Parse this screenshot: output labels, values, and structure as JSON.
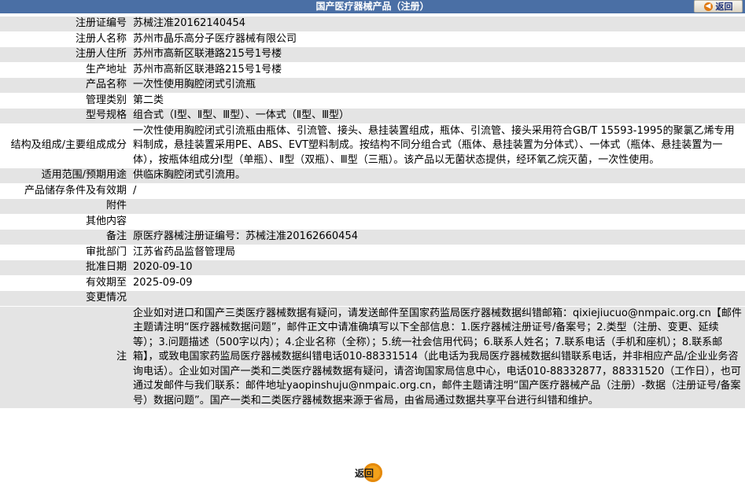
{
  "header": {
    "title": "国产医疗器械产品（注册）",
    "back_label": "返回"
  },
  "rows": [
    {
      "label": "注册证编号",
      "value": "苏械注准20162140454"
    },
    {
      "label": "注册人名称",
      "value": "苏州市晶乐高分子医疗器械有限公司"
    },
    {
      "label": "注册人住所",
      "value": "苏州市高新区联港路215号1号楼"
    },
    {
      "label": "生产地址",
      "value": "苏州市高新区联港路215号1号楼"
    },
    {
      "label": "产品名称",
      "value": "一次性使用胸腔闭式引流瓶"
    },
    {
      "label": "管理类别",
      "value": "第二类"
    },
    {
      "label": "型号规格",
      "value": "组合式（Ⅰ型、Ⅱ型、Ⅲ型）、一体式（Ⅱ型、Ⅲ型）"
    },
    {
      "label": "结构及组成/主要组成成分",
      "value": "一次性使用胸腔闭式引流瓶由瓶体、引流管、接头、悬挂装置组成，瓶体、引流管、接头采用符合GB/T 15593-1995的聚氯乙烯专用料制成，悬挂装置采用PE、ABS、EVT塑料制成。按结构不同分组合式（瓶体、悬挂装置为分体式）、一体式（瓶体、悬挂装置为一体），按瓶体组成分Ⅰ型（单瓶）、Ⅱ型（双瓶）、Ⅲ型（三瓶）。该产品以无菌状态提供，经环氧乙烷灭菌，一次性使用。"
    },
    {
      "label": "适用范围/预期用途",
      "value": "供临床胸腔闭式引流用。"
    },
    {
      "label": "产品储存条件及有效期",
      "value": "/"
    },
    {
      "label": "附件",
      "value": ""
    },
    {
      "label": "其他内容",
      "value": ""
    },
    {
      "label": "备注",
      "value": "原医疗器械注册证编号：苏械注准20162660454"
    },
    {
      "label": "审批部门",
      "value": "江苏省药品监督管理局"
    },
    {
      "label": "批准日期",
      "value": "2020-09-10"
    },
    {
      "label": "有效期至",
      "value": "2025-09-09"
    },
    {
      "label": "变更情况",
      "value": ""
    },
    {
      "label": "注",
      "value": "企业如对进口和国产三类医疗器械数据有疑问，请发送邮件至国家药监局医疗器械数据纠错邮箱：qixiejiucuo@nmpaic.org.cn【邮件主题请注明“医疗器械数据问题”，邮件正文中请准确填写以下全部信息：1.医疗器械注册证号/备案号；2.类型（注册、变更、延续等）；3.问题描述（500字以内）；4.企业名称（全称）；5.统一社会信用代码；6.联系人姓名；7.联系电话（手机和座机）；8.联系邮箱】，或致电国家药监局医疗器械数据纠错电话010-88331514（此电话为我局医疗器械数据纠错联系电话，并非相应产品/企业业务咨询电话）。企业如对国产一类和二类医疗器械数据有疑问，请咨询国家局信息中心，电话010-88332877，88331520（工作日），也可通过发邮件与我们联系：邮件地址yaopinshuju@nmpaic.org.cn，邮件主题请注明“国产医疗器械产品（注册）-数据（注册证号/备案号）数据问题”。国产一类和二类医疗器械数据来源于省局，由省局通过数据共享平台进行纠错和维护。"
    }
  ],
  "footer": {
    "back_label": "返回"
  },
  "colors": {
    "header_bg": "#4a6fa5",
    "row_alt_bg": "#e4e4e4",
    "button_orange": "#f3a21a"
  }
}
